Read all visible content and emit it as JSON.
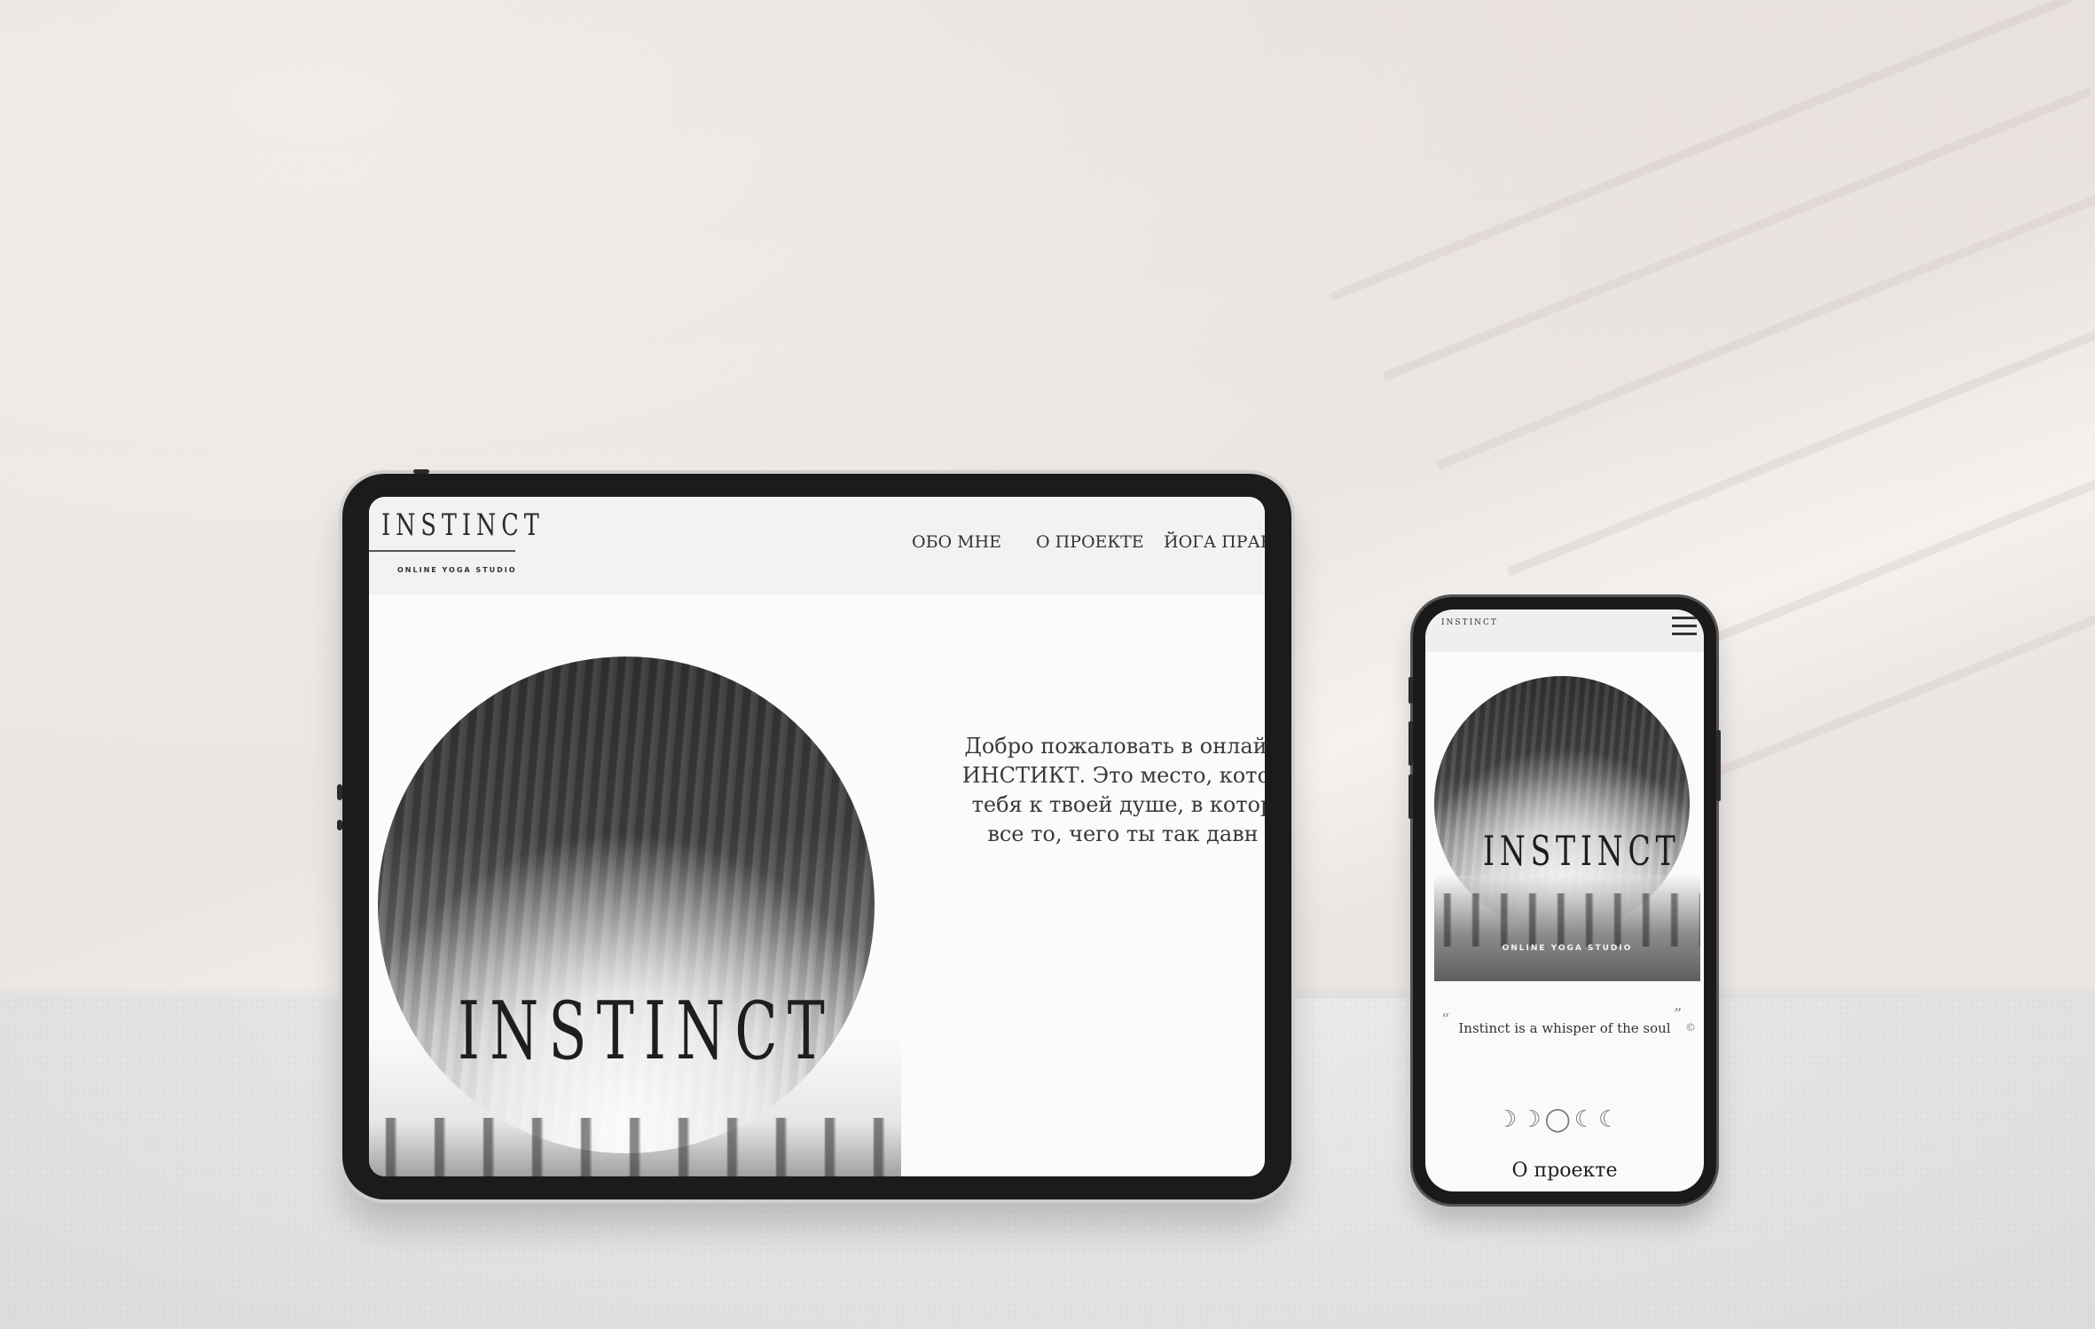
{
  "tablet": {
    "logo": "INSTINCT",
    "logo_subtitle": "ONLINE YOGA STUDIO",
    "nav": [
      "ОБО МНЕ",
      "О ПРОЕКТЕ",
      "ЙОГА ПРАКТ"
    ],
    "hero_title": "INSTINCT",
    "welcome_lines": [
      "Добро пожаловать в онлайн",
      "ИНСТИКТ. Это место, котор",
      "тебя к твоей душе, в котор",
      "все то, чего ты так давн"
    ]
  },
  "phone": {
    "logo": "INSTINCT",
    "menu_icon": "hamburger-icon",
    "hero_title": "INSTINCT",
    "hero_subtitle": "ONLINE YOGA STUDIO",
    "quote": "Instinct is a whisper of the soul",
    "quote_open": "“",
    "quote_close": "”",
    "quote_symbol": "©",
    "moon_phases": "☽☽◯☾☾",
    "section_title": "О проекте"
  }
}
